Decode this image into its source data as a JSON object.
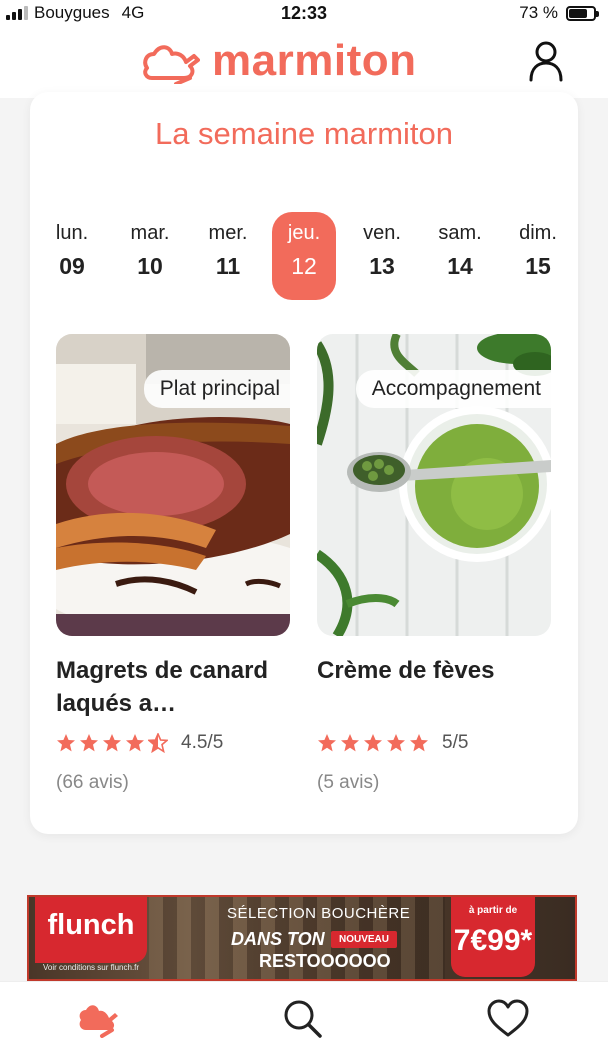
{
  "status_bar": {
    "carrier": "Bouygues",
    "network": "4G",
    "time": "12:33",
    "battery": "73 %",
    "battery_level": 0.73
  },
  "header": {
    "logo_text": "marmiton",
    "brand_color": "#f26b5b"
  },
  "week": {
    "title": "La semaine marmiton",
    "days": [
      {
        "name": "lun.",
        "num": "09"
      },
      {
        "name": "mar.",
        "num": "10"
      },
      {
        "name": "mer.",
        "num": "11"
      },
      {
        "name": "jeu.",
        "num": "12"
      },
      {
        "name": "ven.",
        "num": "13"
      },
      {
        "name": "sam.",
        "num": "14"
      },
      {
        "name": "dim.",
        "num": "15"
      }
    ],
    "selected_day": "jeu."
  },
  "recipes": [
    {
      "tag": "Plat principal",
      "title": "Magrets de canard laqués a…",
      "rating": 4.5,
      "rating_text": "4.5/5",
      "reviews": "(66 avis)"
    },
    {
      "tag": "Accompagnement",
      "title": "Crème de fèves",
      "rating": 5,
      "rating_text": "5/5",
      "reviews": "(5 avis)"
    }
  ],
  "ad": {
    "brand": "flunch",
    "line1": "SÉLECTION BOUCHÈRE",
    "line2": "DANS TON",
    "badge": "NOUVEAU",
    "line3": "RESTOOOOOO",
    "price_label": "à partir de",
    "price": "7€99*",
    "disclaimer": "Voir conditions sur flunch.fr"
  },
  "nav": {
    "icons": [
      "chef-hat-icon",
      "search-icon",
      "heart-icon"
    ]
  }
}
